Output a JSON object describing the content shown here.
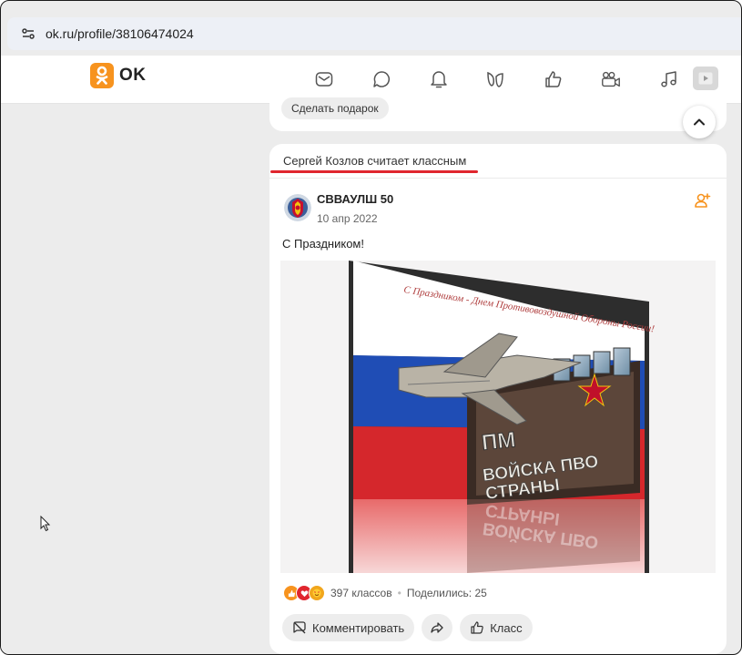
{
  "browser": {
    "url": "ok.ru/profile/38106474024"
  },
  "header": {
    "logo_text": "OK",
    "nav_icons": [
      "mail-icon",
      "chat-icon",
      "bell-icon",
      "guests-icon",
      "like-icon",
      "video-chat-icon",
      "music-icon",
      "video-icon"
    ],
    "brand_color": "#f7931e"
  },
  "top_card": {
    "gift_button": "Сделать подарок"
  },
  "post_card": {
    "context_text": "Сергей Козлов считает классным",
    "accent_color": "#e0262e",
    "author": "СВВАУЛШ 50",
    "date": "10 апр 2022",
    "text": "С Праздником!",
    "image": {
      "greeting": "С Праздником - Днем Противовоздушной Обороны России!",
      "badge_line1": "ВОЙСКА ПВО",
      "badge_line2": "СТРАНЫ",
      "emblem": "ПМ"
    },
    "stats": {
      "likes": "397 классов",
      "separator": "•",
      "shares": "Поделились: 25"
    },
    "actions": {
      "comment": "Комментировать",
      "like": "Класс"
    }
  }
}
